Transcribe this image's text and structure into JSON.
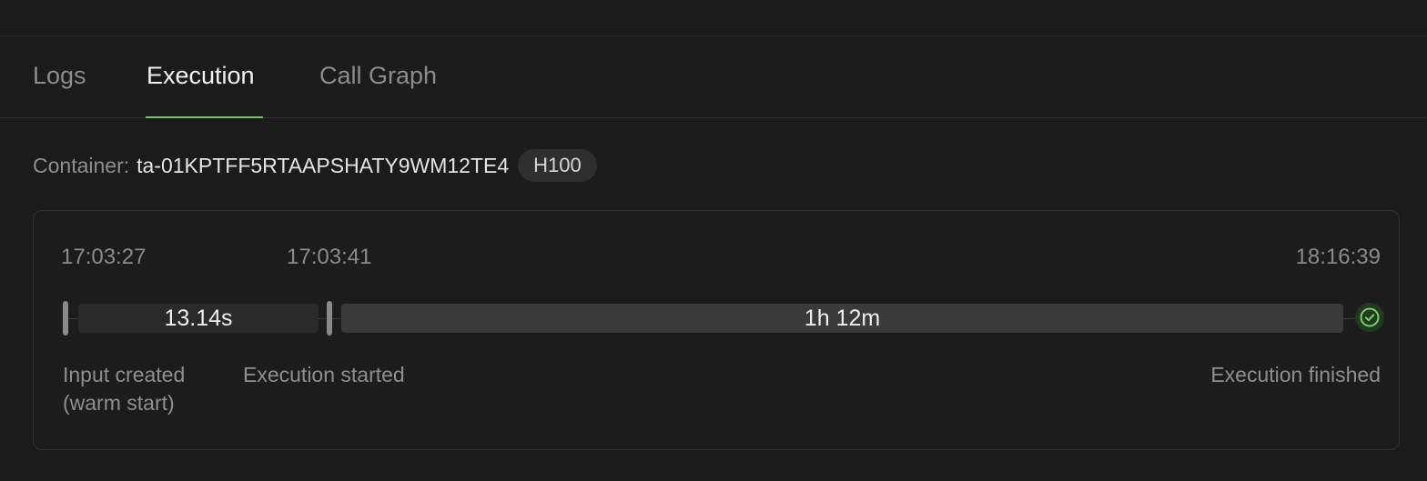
{
  "tabs": [
    {
      "label": "Logs"
    },
    {
      "label": "Execution"
    },
    {
      "label": "Call Graph"
    }
  ],
  "active_tab": "Execution",
  "container": {
    "label": "Container:",
    "id": "ta-01KPTFF5RTAAPSHATY9WM12TE4",
    "gpu": "H100"
  },
  "timeline": {
    "times": {
      "input_created": "17:03:27",
      "execution_started": "17:03:41",
      "execution_finished": "18:16:39"
    },
    "durations": {
      "startup": "13.14s",
      "execution": "1h 12m"
    },
    "events": {
      "input_created_line1": "Input created",
      "input_created_line2": "(warm start)",
      "execution_started": "Execution started",
      "execution_finished": "Execution finished"
    },
    "status": "success"
  },
  "colors": {
    "accent": "#73c168",
    "background": "#1b1b1b"
  }
}
